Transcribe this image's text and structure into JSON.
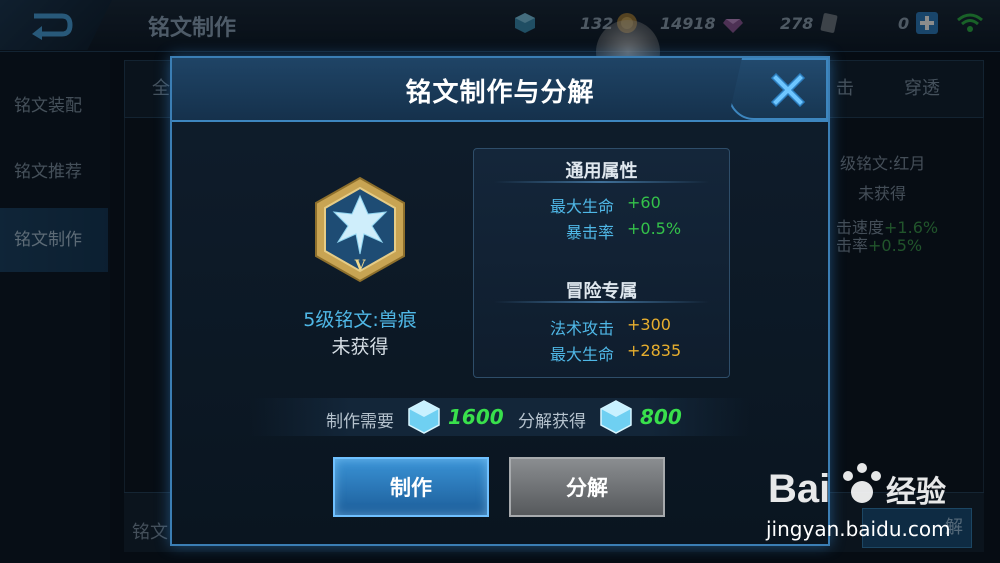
{
  "topbar": {
    "page_title": "铭文制作",
    "resources": [
      {
        "name": "coin",
        "value": "132",
        "icon": "coin-icon"
      },
      {
        "name": "diamond",
        "value": "14918",
        "icon": "diamond-icon"
      },
      {
        "name": "rune-fragment",
        "value": "278",
        "icon": "rune-fragment-icon"
      },
      {
        "name": "voucher",
        "value": "0",
        "icon": "plus-icon"
      }
    ]
  },
  "sidebar": {
    "items": [
      {
        "label": "铭文装配"
      },
      {
        "label": "铭文推荐"
      },
      {
        "label": "铭文制作"
      }
    ]
  },
  "background": {
    "tabs": [
      "全",
      "击",
      "穿透"
    ],
    "card_name": "级铭文:红月",
    "card_status": "未获得",
    "stat1": "击速度",
    "stat1_val": "+1.6%",
    "stat2": "击率",
    "stat2_val": "+0.5%",
    "bottom_label": "铭文",
    "bottom_btn": "解"
  },
  "dialog": {
    "title": "铭文制作与分解",
    "rune_level_mark": "V",
    "rune_name": "5级铭文:兽痕",
    "rune_status": "未获得",
    "general_title": "通用属性",
    "general_attrs": [
      {
        "label": "最大生命",
        "value": "+60"
      },
      {
        "label": "暴击率",
        "value": "+0.5%"
      }
    ],
    "adventure_title": "冒险专属",
    "adventure_attrs": [
      {
        "label": "法术攻击",
        "value": "+300"
      },
      {
        "label": "最大生命",
        "value": "+2835"
      }
    ],
    "make_cost_label": "制作需要",
    "make_cost_value": "1600",
    "decompose_gain_label": "分解获得",
    "decompose_gain_value": "800",
    "make_button": "制作",
    "decompose_button": "分解"
  },
  "watermark": {
    "brand": "Bai",
    "brand_suffix": "经验",
    "url": "jingyan.baidu.com"
  },
  "colors": {
    "accent_blue": "#4fb7e6",
    "value_green": "#34c24a",
    "value_yellow": "#e6ae2e",
    "cost_green": "#39e04c"
  }
}
